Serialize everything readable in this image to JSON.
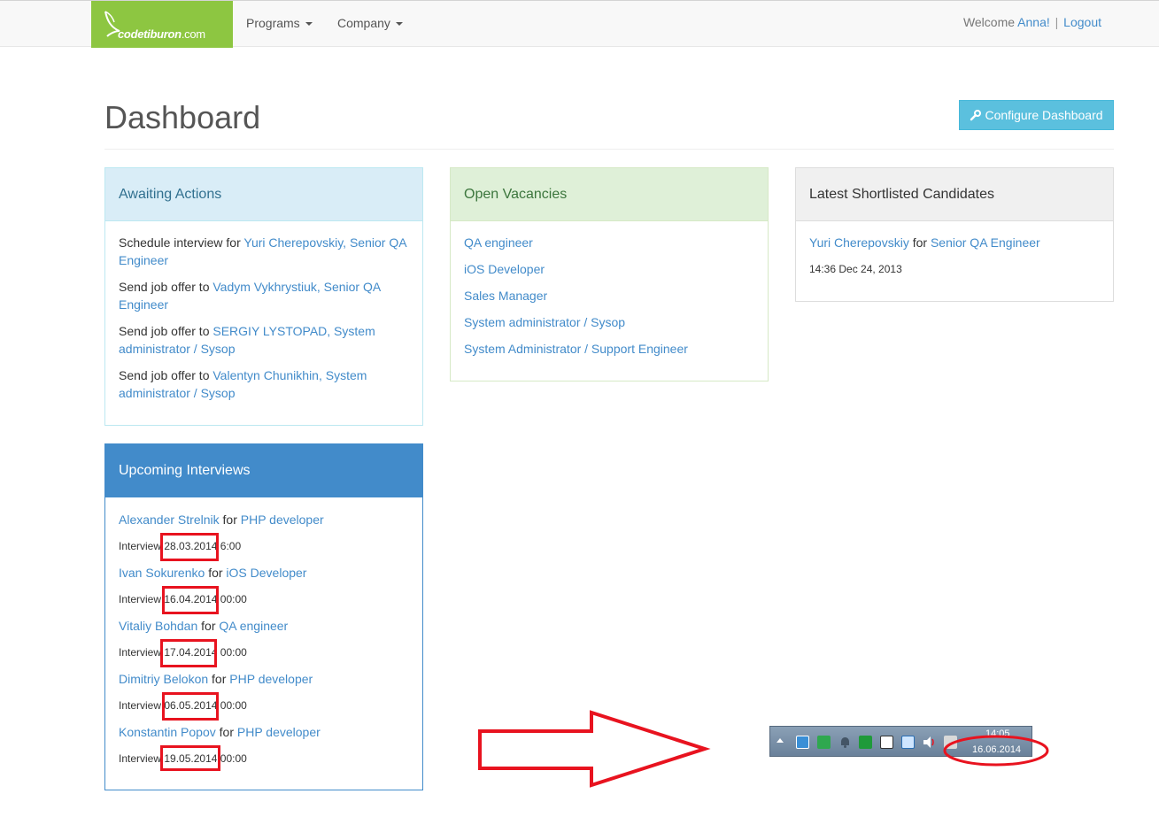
{
  "nav": {
    "brand_name": "codetiburon",
    "brand_tld": ".com",
    "programs": "Programs",
    "company": "Company",
    "welcome": "Welcome",
    "user": "Anna!",
    "separator": "|",
    "logout": "Logout"
  },
  "page": {
    "title": "Dashboard",
    "configure_button": "Configure Dashboard"
  },
  "awaiting": {
    "title": "Awaiting Actions",
    "items": [
      {
        "action": "Schedule interview for",
        "link": "Yuri Cherepovskiy, Senior QA Engineer"
      },
      {
        "action": "Send job offer to",
        "link": "Vadym Vykhrystiuk, Senior QA Engineer"
      },
      {
        "action": "Send job offer to",
        "link": "SERGIY LYSTOPAD, System administrator / Sysop"
      },
      {
        "action": "Send job offer to",
        "link": "Valentyn Chunikhin, System administrator / Sysop"
      }
    ]
  },
  "vacancies": {
    "title": "Open Vacancies",
    "items": [
      "QA engineer",
      "iOS Developer",
      "Sales Manager",
      "System administrator / Sysop",
      "System Administrator / Support Engineer"
    ]
  },
  "shortlisted": {
    "title": "Latest Shortlisted Candidates",
    "candidate": "Yuri Cherepovskiy",
    "for": "for",
    "position": "Senior QA Engineer",
    "timestamp": "14:36 Dec 24, 2013"
  },
  "interviews": {
    "title": "Upcoming Interviews",
    "for": "for",
    "label": "Interview",
    "items": [
      {
        "name": "Alexander Strelnik",
        "position": "PHP developer",
        "date": "28.03.2014",
        "time": "6:00"
      },
      {
        "name": "Ivan Sokurenko",
        "position": "iOS Developer",
        "date": "16.04.2014",
        "time": "00:00"
      },
      {
        "name": "Vitaliy Bohdan",
        "position": "QA engineer",
        "date": "17.04.2014",
        "time": "00:00"
      },
      {
        "name": "Dimitriy Belokon",
        "position": "PHP developer",
        "date": "06.05.2014",
        "time": "00:00"
      },
      {
        "name": "Konstantin Popov",
        "position": "PHP developer",
        "date": "19.05.2014",
        "time": "00:00"
      }
    ]
  },
  "taskbar": {
    "time": "14:05",
    "date": "16.06.2014"
  },
  "colors": {
    "brand": "#8dc641",
    "link": "#428bca",
    "annotation": "#e8131f",
    "info_button": "#5bc0de"
  }
}
